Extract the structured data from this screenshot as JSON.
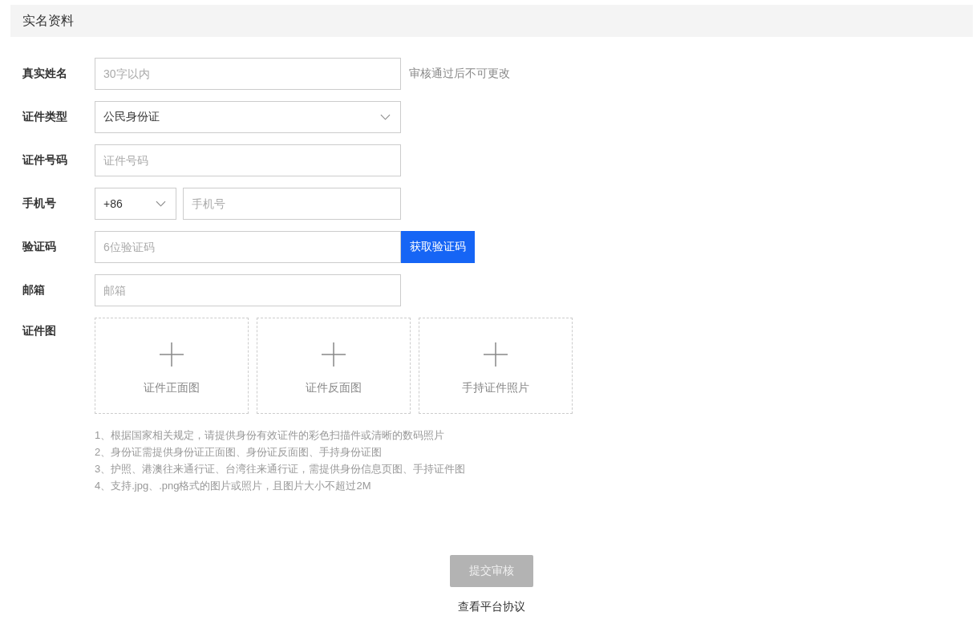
{
  "section_title": "实名资料",
  "fields": [
    {
      "kind": "text",
      "label": "真实姓名",
      "placeholder": "30字以内",
      "hint": "审核通过后不可更改"
    },
    {
      "kind": "select",
      "label": "证件类型",
      "value": "公民身份证"
    },
    {
      "kind": "text",
      "label": "证件号码",
      "placeholder": "证件号码"
    },
    {
      "kind": "phone",
      "label": "手机号",
      "code": "+86",
      "placeholder": "手机号"
    },
    {
      "kind": "code",
      "label": "验证码",
      "placeholder": "6位验证码",
      "button": "获取验证码"
    },
    {
      "kind": "text",
      "label": "邮箱",
      "placeholder": "邮箱"
    }
  ],
  "uploads": {
    "label": "证件图",
    "slots": [
      {
        "caption": "证件正面图"
      },
      {
        "caption": "证件反面图"
      },
      {
        "caption": "手持证件照片"
      }
    ]
  },
  "notes": [
    "1、根据国家相关规定，请提供身份有效证件的彩色扫描件或清晰的数码照片",
    "2、身份证需提供身份证正面图、身份证反面图、手持身份证图",
    "3、护照、港澳往来通行证、台湾往来通行证，需提供身份信息页图、手持证件图",
    "4、支持.jpg、.png格式的图片或照片，且图片大小不超过2M"
  ],
  "submit": {
    "label": "提交审核",
    "disabled": true
  },
  "agreement_link": "查看平台协议"
}
